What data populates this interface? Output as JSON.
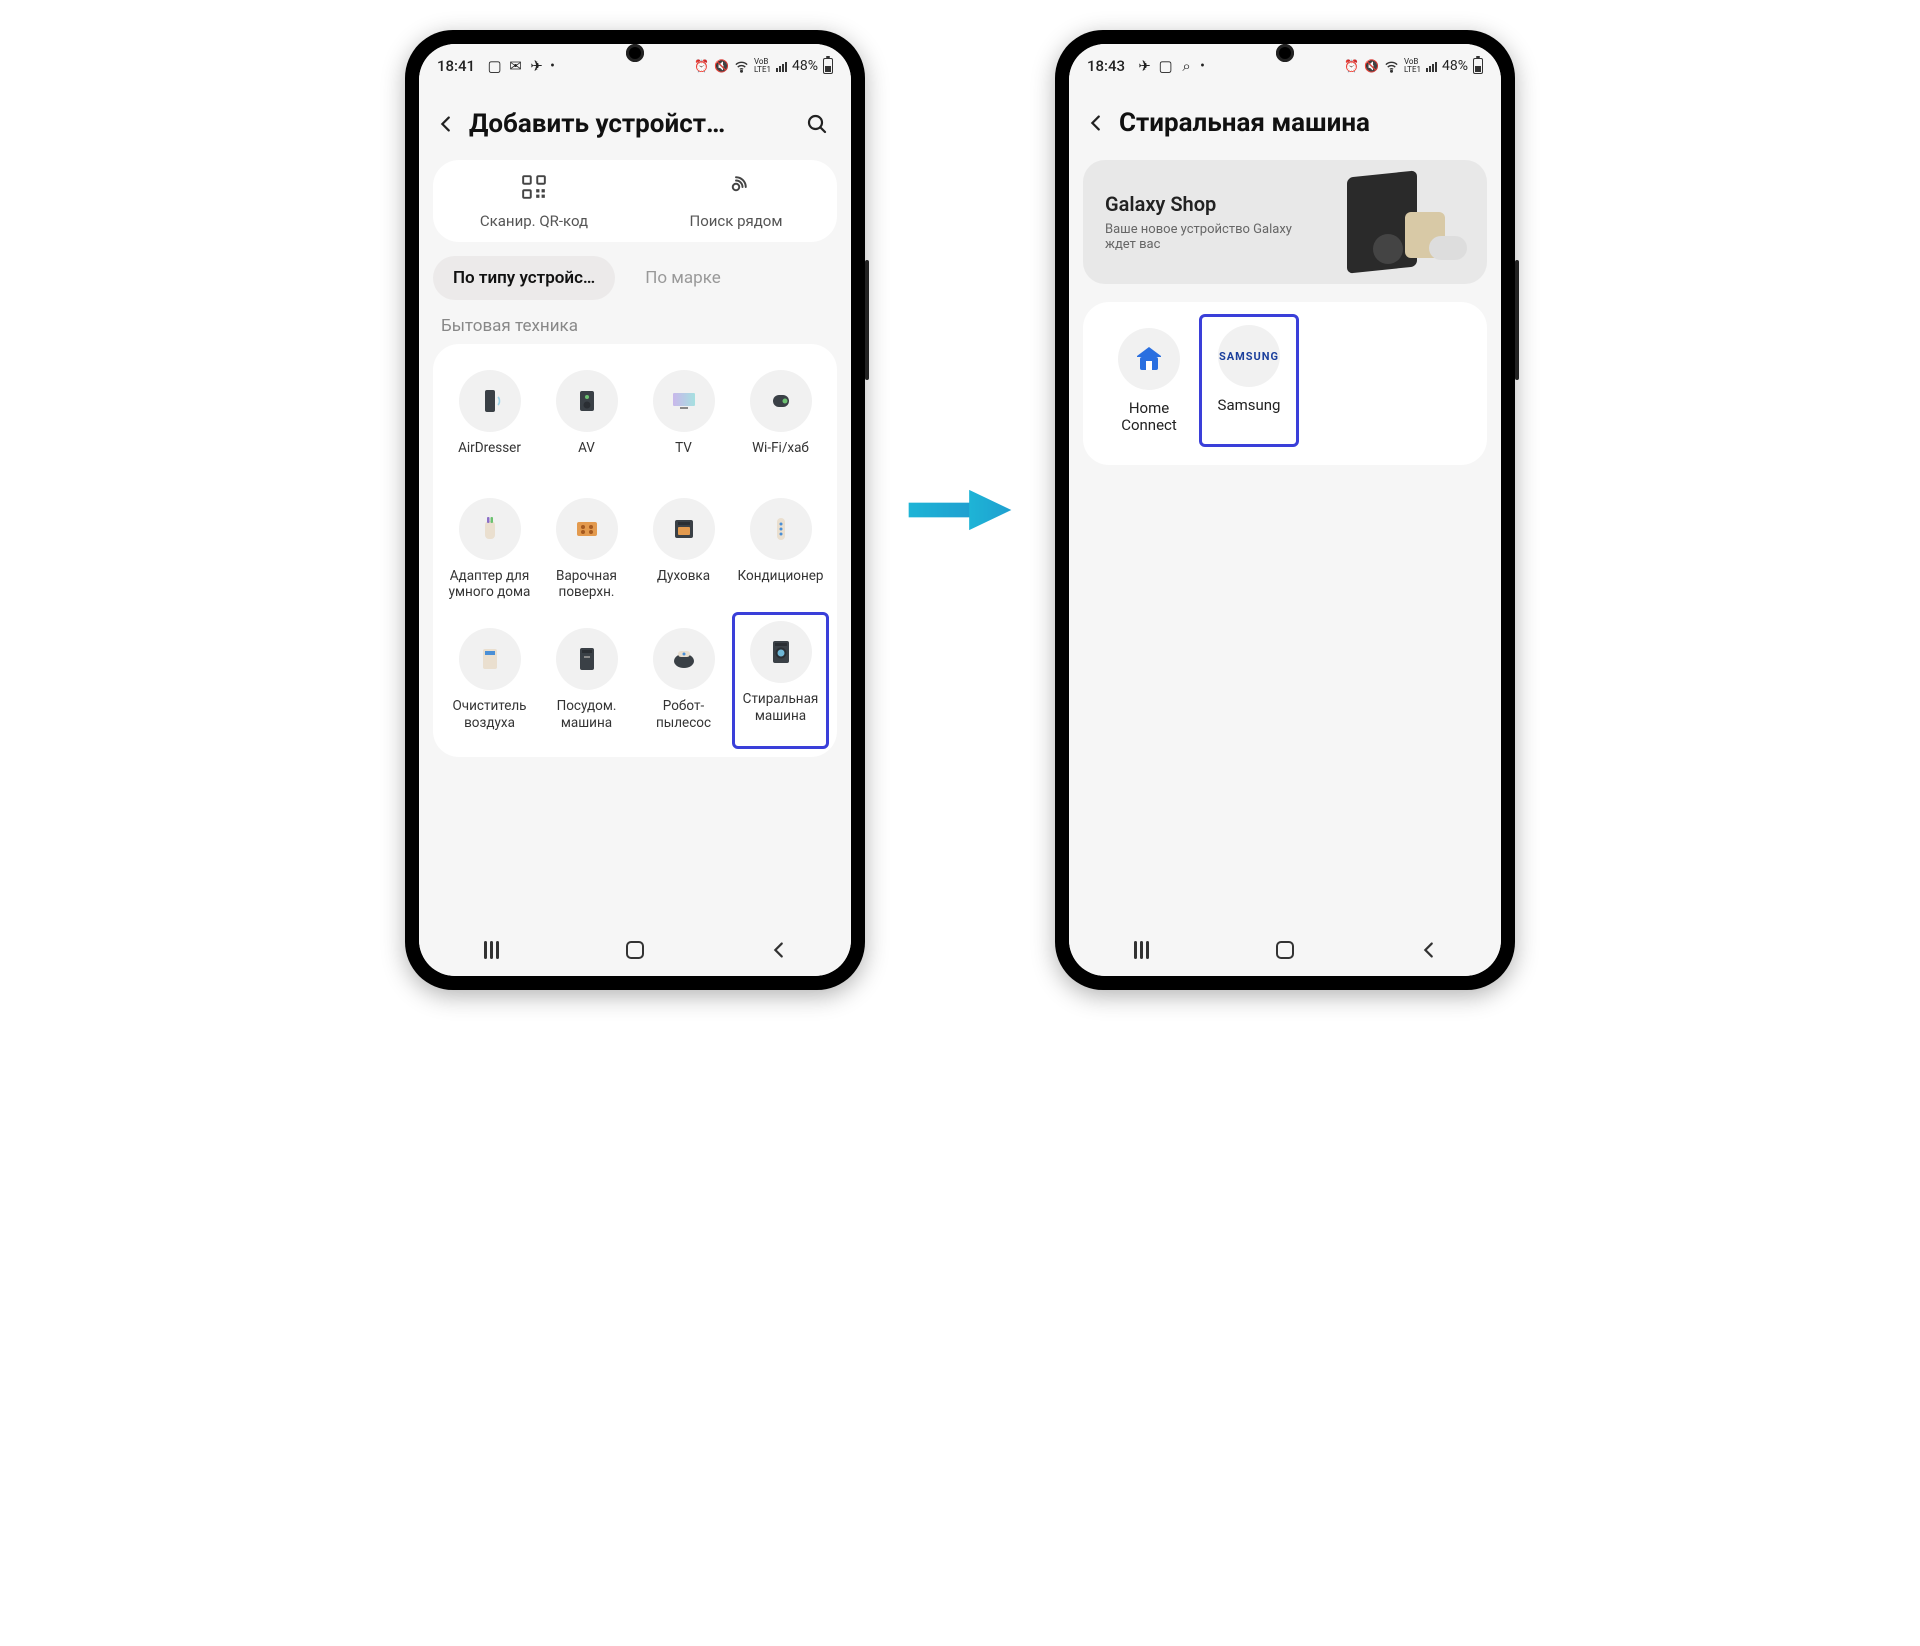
{
  "phone1": {
    "status": {
      "time": "18:41",
      "battery": "48%"
    },
    "header": {
      "title": "Добавить устройст…"
    },
    "actions": [
      {
        "label": "Сканир. QR-код"
      },
      {
        "label": "Поиск рядом"
      }
    ],
    "tabs": [
      {
        "label": "По типу устройс…",
        "active": true
      },
      {
        "label": "По марке",
        "active": false
      }
    ],
    "section_label": "Бытовая техника",
    "devices": [
      {
        "label": "AirDresser"
      },
      {
        "label": "AV"
      },
      {
        "label": "TV"
      },
      {
        "label": "Wi-Fi/хаб"
      },
      {
        "label": "Адаптер для умного дома"
      },
      {
        "label": "Варочная поверхн."
      },
      {
        "label": "Духовка"
      },
      {
        "label": "Кондиционер"
      },
      {
        "label": "Очиститель воздуха"
      },
      {
        "label": "Посудом. машина"
      },
      {
        "label": "Робот-пылесос"
      },
      {
        "label": "Стиральная машина",
        "highlighted": true
      }
    ]
  },
  "phone2": {
    "status": {
      "time": "18:43",
      "battery": "48%"
    },
    "header": {
      "title": "Стиральная машина"
    },
    "promo": {
      "title": "Galaxy Shop",
      "subtitle": "Ваше новое устройство Galaxy ждет вас"
    },
    "brands": [
      {
        "label": "Home Connect"
      },
      {
        "label": "Samsung",
        "logo": "SAMSUNG",
        "highlighted": true
      }
    ]
  }
}
